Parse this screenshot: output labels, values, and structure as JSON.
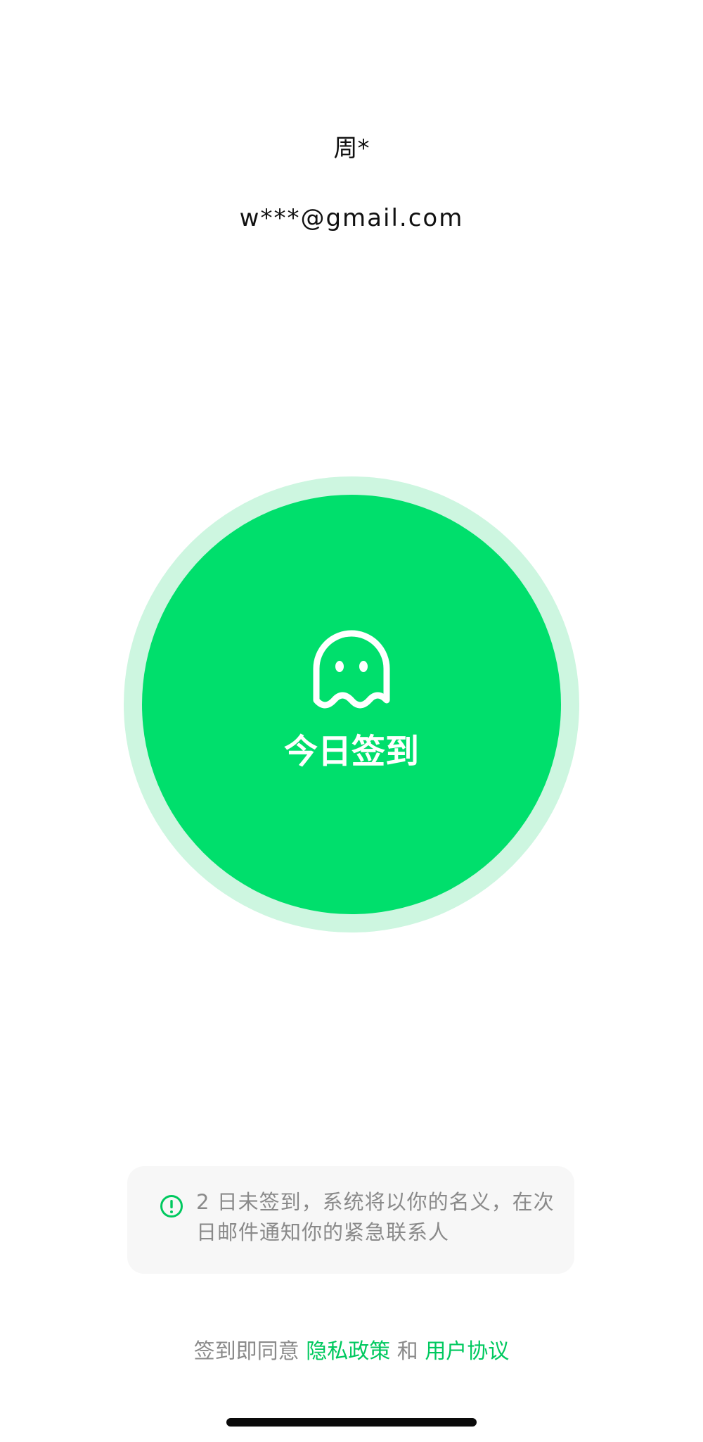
{
  "user": {
    "name": "周*",
    "email": "w***@gmail.com"
  },
  "checkin": {
    "label": "今日签到",
    "icon": "ghost-icon",
    "color": "#00df6c",
    "ring_color": "#cdf6e0"
  },
  "notice": {
    "icon": "exclamation-circle-icon",
    "text": "2 日未签到，系统将以你的名义，在次日邮件通知你的紧急联系人"
  },
  "agreement": {
    "prefix": "签到即同意",
    "privacy_link": "隐私政策",
    "conjunction": "和",
    "terms_link": "用户协议",
    "link_color": "#00c95f"
  }
}
